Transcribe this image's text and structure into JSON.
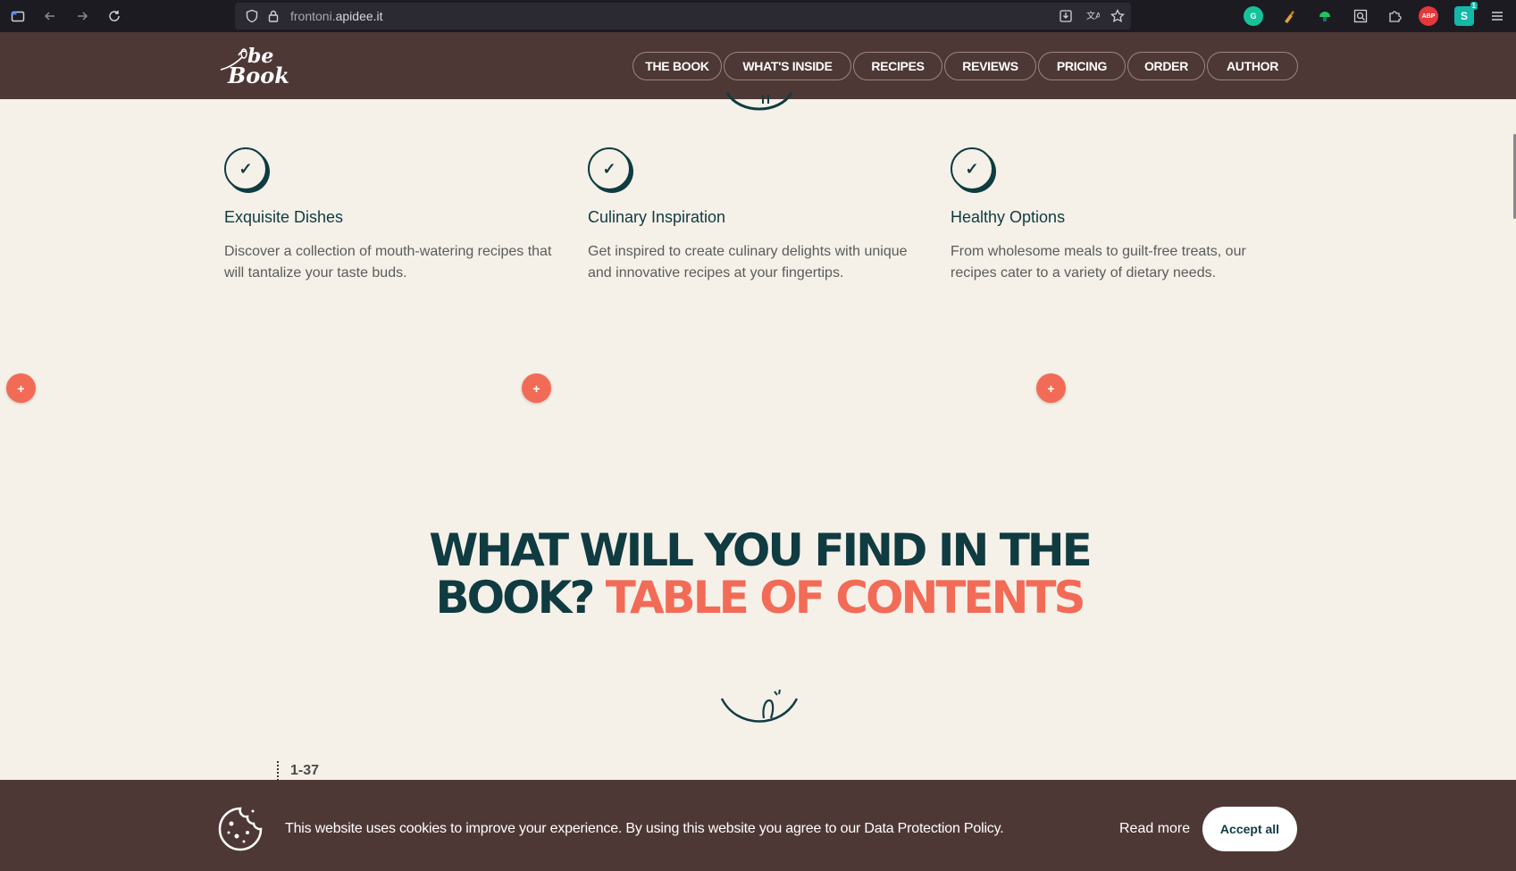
{
  "browser": {
    "url_prefix": "frontoni.",
    "url_domain": "apidee.it",
    "extensions": [
      {
        "name": "grammarly-icon",
        "label": "G",
        "color": "#15c39a"
      },
      {
        "name": "sweep-icon",
        "label": "",
        "color": "#e0a13a"
      },
      {
        "name": "mushroom-icon",
        "label": "",
        "color": "#22c55e"
      },
      {
        "name": "search-page-icon",
        "label": "",
        "color": "#5b5b66"
      },
      {
        "name": "puzzle-icon",
        "label": "",
        "color": "#5b5b66"
      },
      {
        "name": "adblock-icon",
        "label": "ABP",
        "color": "#e5383b"
      },
      {
        "name": "s-extension-icon",
        "label": "S",
        "color": "#14b8a6"
      }
    ],
    "badge_count": "1"
  },
  "header": {
    "logo_line1": "be",
    "logo_line2": "Book",
    "nav": [
      {
        "label": "THE BOOK",
        "width": 100
      },
      {
        "label": "WHAT'S INSIDE",
        "width": 143
      },
      {
        "label": "RECIPES",
        "width": 100
      },
      {
        "label": "REVIEWS",
        "width": 103
      },
      {
        "label": "PRICING",
        "width": 98
      },
      {
        "label": "ORDER",
        "width": 87
      },
      {
        "label": "AUTHOR",
        "width": 102
      }
    ]
  },
  "features": [
    {
      "title": "Exquisite Dishes",
      "description": "Discover a collection of mouth-watering recipes that will tantalize your taste buds."
    },
    {
      "title": "Culinary Inspiration",
      "description": "Get inspired to create culinary delights with unique and innovative recipes at your fingertips."
    },
    {
      "title": "Healthy Options",
      "description": "From wholesome meals to guilt-free treats, our recipes cater to a variety of dietary needs."
    }
  ],
  "plus_label": "+",
  "heading": {
    "part1": "WHAT WILL YOU FIND IN THE BOOK?",
    "part2": "TABLE OF CONTENTS"
  },
  "toc_range": "1-37",
  "cookie": {
    "text": "This website uses cookies to improve your experience. By using this website you agree to our Data Protection Policy.",
    "read_more": "Read more",
    "accept": "Accept all"
  },
  "colors": {
    "brand_brown": "#4e3835",
    "dark_teal": "#0f3b41",
    "accent_coral": "#f26b57",
    "page_bg": "#f5f1e8"
  }
}
